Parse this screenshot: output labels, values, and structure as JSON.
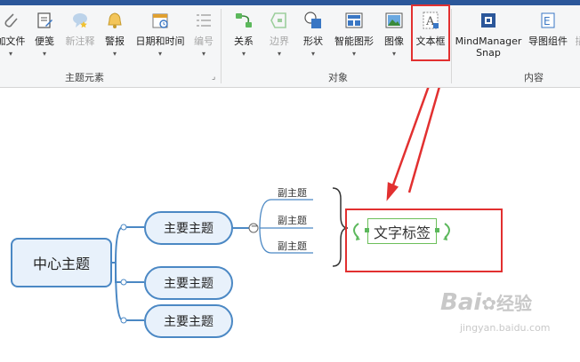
{
  "ribbon": {
    "groups": {
      "topic_elements": "主题元素",
      "objects": "对象",
      "content": "内容"
    },
    "buttons": {
      "attach_file": "加文件",
      "note": "便笺",
      "comment": "新注释",
      "alert": "警报",
      "date_time": "日期和时间",
      "numbering": "编号",
      "relationship": "关系",
      "boundary": "边界",
      "shape": "形状",
      "smart_shape": "智能图形",
      "image": "图像",
      "text_box": "文本框",
      "mindmanager_snap_line1": "MindManager",
      "mindmanager_snap_line2": "Snap",
      "map_parts": "导图组件",
      "insert_partial": "插"
    },
    "dropdown_glyph": "▾"
  },
  "map": {
    "central_topic": "中心主题",
    "main_topics": [
      "主要主题",
      "主要主题",
      "主要主题"
    ],
    "subtopics": [
      "副主题",
      "副主题",
      "副主题"
    ],
    "collapse_glyph": "−",
    "floating_text": "文字标签"
  },
  "watermark": {
    "brand": "Bai",
    "brand2": "经验",
    "url": "jingyan.baidu.com"
  },
  "colors": {
    "ribbon_bar": "#2b579a",
    "topic_border": "#4b88c4",
    "topic_fill": "#e8f1fb",
    "highlight": "#e23030",
    "text_box_border": "#6cbf5a"
  }
}
